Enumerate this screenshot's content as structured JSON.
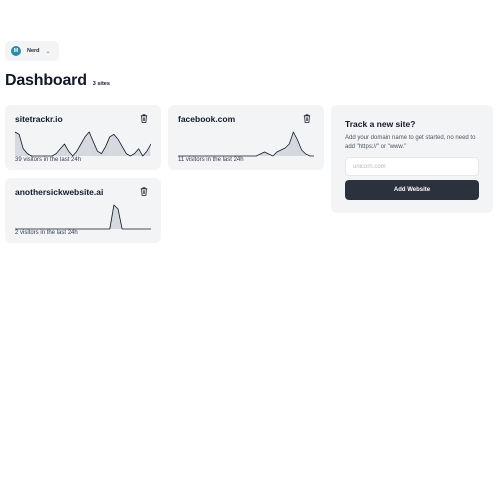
{
  "user": {
    "initial": "M",
    "name": "Nerd"
  },
  "header": {
    "title": "Dashboard",
    "site_count": "3 sites"
  },
  "sites": [
    {
      "domain": "sitetrackr.io",
      "visitors_text": "39 visitors in the last 24h",
      "series": [
        10,
        9,
        3,
        1,
        0,
        0,
        0,
        0,
        0,
        0,
        1,
        3,
        5,
        2,
        0,
        2,
        5,
        8,
        10,
        6,
        2,
        1,
        4,
        8,
        9,
        7,
        4,
        1,
        0,
        1,
        3,
        0,
        2,
        5
      ]
    },
    {
      "domain": "facebook.com",
      "visitors_text": "11 visitors in the last 24h",
      "series": [
        0,
        0,
        0,
        0,
        0,
        0,
        0,
        0,
        0,
        0,
        0,
        0,
        0,
        0,
        0,
        0,
        0,
        0,
        0,
        0,
        1,
        2,
        1,
        0,
        2,
        3,
        4,
        6,
        12,
        8,
        3,
        1,
        0,
        0
      ]
    },
    {
      "domain": "anothersickwebsite.ai",
      "visitors_text": "2 visitors in the last 24h",
      "series": [
        0,
        0,
        0,
        0,
        0,
        0,
        0,
        0,
        0,
        0,
        0,
        0,
        0,
        0,
        0,
        0,
        0,
        0,
        0,
        0,
        0,
        0,
        0,
        0,
        12,
        10,
        0,
        0,
        0,
        0,
        0,
        0,
        0,
        0
      ]
    }
  ],
  "track": {
    "title": "Track a new site?",
    "description": "Add your domain name to get started, no need to add \"https://\" or \"www.\"",
    "placeholder": "unicorn.com",
    "button_label": "Add Website"
  },
  "colors": {
    "accent": "#2b313d",
    "avatar": "#2d8ca8",
    "card_bg": "#f3f4f6"
  }
}
